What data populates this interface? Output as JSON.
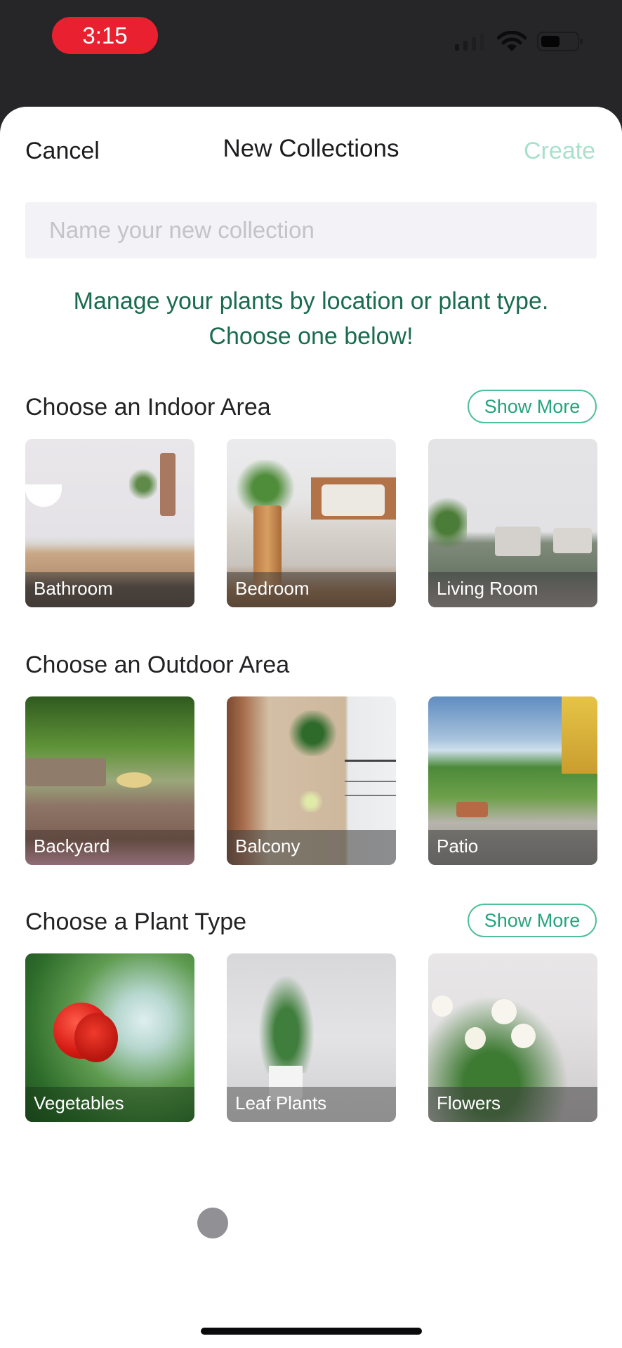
{
  "status_bar": {
    "time": "3:15",
    "time_pill_color": "#e8202f",
    "icons": [
      "signal-icon",
      "wifi-icon",
      "battery-icon"
    ]
  },
  "header": {
    "cancel_label": "Cancel",
    "title": "New Collections",
    "create_label": "Create",
    "create_color": "#a9e0cc"
  },
  "name_input": {
    "value": "",
    "placeholder": "Name your new collection"
  },
  "subtitle": {
    "line1": "Manage your plants by location or plant type.",
    "line2": "Choose one below!",
    "color": "#1b6b4f"
  },
  "sections": [
    {
      "heading": "Choose an Indoor Area",
      "show_more_label": "Show More",
      "tiles": [
        {
          "label": "Bathroom"
        },
        {
          "label": "Bedroom"
        },
        {
          "label": "Living Room"
        }
      ]
    },
    {
      "heading": "Choose an Outdoor Area",
      "tiles": [
        {
          "label": "Backyard"
        },
        {
          "label": "Balcony"
        },
        {
          "label": "Patio"
        }
      ]
    },
    {
      "heading": "Choose a Plant Type",
      "show_more_label": "Show More",
      "tiles": [
        {
          "label": "Vegetables"
        },
        {
          "label": "Leaf Plants"
        },
        {
          "label": "Flowers"
        }
      ]
    }
  ],
  "accent_color": "#26a37c"
}
